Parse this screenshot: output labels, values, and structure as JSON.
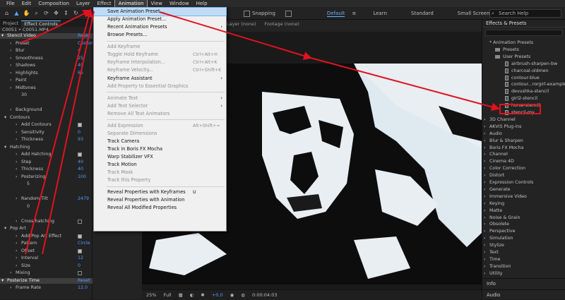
{
  "menubar": {
    "items": [
      "File",
      "Edit",
      "Composition",
      "Layer",
      "Effect",
      "Animation",
      "View",
      "Window",
      "Help"
    ],
    "active_index": 5
  },
  "toolbar": {
    "snapping_label": "Snapping",
    "workspaces": [
      "Default",
      "Learn",
      "Standard",
      "Small Screen"
    ],
    "active_workspace": "Default",
    "search_placeholder": "Search Help"
  },
  "left_panel": {
    "tabs": [
      "Project",
      "Effect Controls"
    ],
    "layer_name": "C0051 • C0051.MP4",
    "rows": [
      {
        "label": "Stencil Video",
        "value": "Reset",
        "indent": 10,
        "type": "fxhead"
      },
      {
        "label": "Preset",
        "value": "Custom",
        "indent": 22,
        "type": "prop"
      },
      {
        "label": "Blur",
        "value": "4",
        "indent": 22,
        "type": "prop"
      },
      {
        "label": "Smoothness",
        "value": "25",
        "indent": 22,
        "type": "prop"
      },
      {
        "label": "Shadows",
        "value": "40",
        "indent": 22,
        "type": "prop"
      },
      {
        "label": "Highlights",
        "value": "65",
        "indent": 22,
        "type": "prop"
      },
      {
        "label": "Paint",
        "value": "",
        "indent": 22,
        "type": "prop"
      },
      {
        "label": "Midtones",
        "value": "",
        "indent": 22,
        "type": "prop"
      },
      {
        "label": "30",
        "value": "",
        "indent": 30,
        "type": "prop"
      },
      {
        "label": "",
        "value": "",
        "indent": 0,
        "type": "blank"
      },
      {
        "label": "Background",
        "value": "",
        "indent": 22,
        "type": "prop"
      },
      {
        "label": "Contours",
        "value": "",
        "indent": 14,
        "type": "group"
      },
      {
        "label": "Add Contours",
        "value": "",
        "indent": 30,
        "type": "check"
      },
      {
        "label": "Sensitivity",
        "value": "0",
        "indent": 30,
        "type": "prop"
      },
      {
        "label": "Thickness",
        "value": "93",
        "indent": 30,
        "type": "prop"
      },
      {
        "label": "Hatching",
        "value": "",
        "indent": 14,
        "type": "group"
      },
      {
        "label": "Add Hatching",
        "value": "",
        "indent": 30,
        "type": "check"
      },
      {
        "label": "Step",
        "value": "40",
        "indent": 30,
        "type": "prop"
      },
      {
        "label": "Thickness",
        "value": "40",
        "indent": 30,
        "type": "prop"
      },
      {
        "label": "Posterizing",
        "value": "100",
        "indent": 30,
        "type": "prop"
      },
      {
        "label": "5",
        "value": "",
        "indent": 38,
        "type": "prop"
      },
      {
        "label": "",
        "value": "",
        "indent": 0,
        "type": "blank"
      },
      {
        "label": "Random Tilt",
        "value": "2479",
        "indent": 30,
        "type": "prop"
      },
      {
        "label": "0",
        "value": "",
        "indent": 38,
        "type": "prop"
      },
      {
        "label": "",
        "value": "",
        "indent": 0,
        "type": "blank"
      },
      {
        "label": "Cross-hatching",
        "value": "",
        "indent": 30,
        "type": "check-off"
      },
      {
        "label": "Pop Art",
        "value": "",
        "indent": 14,
        "type": "group"
      },
      {
        "label": "Add Pop Art Effect",
        "value": "",
        "indent": 30,
        "type": "check"
      },
      {
        "label": "Pattern",
        "value": "Circle",
        "indent": 30,
        "type": "prop"
      },
      {
        "label": "Offset",
        "value": "",
        "indent": 30,
        "type": "check"
      },
      {
        "label": "Interval",
        "value": "12",
        "indent": 30,
        "type": "prop"
      },
      {
        "label": "Size",
        "value": "0",
        "indent": 30,
        "type": "prop"
      },
      {
        "label": "Mixing",
        "value": "",
        "indent": 22,
        "type": "check-off"
      },
      {
        "label": "Posterize Time",
        "value": "Reset",
        "indent": 10,
        "type": "fxhead"
      },
      {
        "label": "Frame Rate",
        "value": "12,0",
        "indent": 22,
        "type": "prop"
      }
    ]
  },
  "comp_area": {
    "tabs": [
      "Layer (none)",
      "Footage (none)"
    ],
    "viewbar": {
      "zoom": "25%",
      "resolution": "Full",
      "exposure": "+0,0",
      "timecode": "0:00:04:03"
    }
  },
  "dropdown": {
    "items": [
      {
        "label": "Save Animation Preset...",
        "state": "highlight"
      },
      {
        "label": "Apply Animation Preset...",
        "state": "normal"
      },
      {
        "label": "Recent Animation Presets",
        "state": "normal",
        "submenu": true
      },
      {
        "label": "Browse Presets...",
        "state": "normal"
      },
      {
        "sep": true
      },
      {
        "label": "Add Keyframe",
        "state": "disabled"
      },
      {
        "label": "Toggle Hold Keyframe",
        "state": "disabled",
        "shortcut": "Ctrl+Alt+H"
      },
      {
        "label": "Keyframe Interpolation...",
        "state": "disabled",
        "shortcut": "Ctrl+Alt+K"
      },
      {
        "label": "Keyframe Velocity...",
        "state": "disabled",
        "shortcut": "Ctrl+Shift+K"
      },
      {
        "label": "Keyframe Assistant",
        "state": "normal",
        "submenu": true
      },
      {
        "label": "Add Property to Essential Graphics",
        "state": "disabled"
      },
      {
        "sep": true
      },
      {
        "label": "Animate Text",
        "state": "disabled",
        "submenu": true
      },
      {
        "label": "Add Text Selector",
        "state": "disabled",
        "submenu": true
      },
      {
        "label": "Remove All Text Animators",
        "state": "disabled"
      },
      {
        "sep": true
      },
      {
        "label": "Add Expression",
        "state": "disabled",
        "shortcut": "Alt+Shift+="
      },
      {
        "label": "Separate Dimensions",
        "state": "disabled"
      },
      {
        "label": "Track Camera",
        "state": "normal"
      },
      {
        "label": "Track in Boris FX Mocha",
        "state": "normal"
      },
      {
        "label": "Warp Stabilizer VFX",
        "state": "normal"
      },
      {
        "label": "Track Motion",
        "state": "normal"
      },
      {
        "label": "Track Mask",
        "state": "disabled"
      },
      {
        "label": "Track this Property",
        "state": "disabled"
      },
      {
        "sep": true
      },
      {
        "label": "Reveal Properties with Keyframes",
        "state": "normal",
        "shortcut": "U"
      },
      {
        "label": "Reveal Properties with Animation",
        "state": "normal"
      },
      {
        "label": "Reveal All Modified Properties",
        "state": "normal"
      }
    ]
  },
  "effects_panel": {
    "title": "Effects & Presets",
    "items": [
      {
        "label": "* Animation Presets",
        "indent": 4,
        "kind": "text"
      },
      {
        "label": "Presets",
        "indent": 18,
        "kind": "folder"
      },
      {
        "label": "User Presets",
        "indent": 18,
        "kind": "folder"
      },
      {
        "label": "airbrush-sharpen-bw",
        "indent": 32,
        "kind": "preset"
      },
      {
        "label": "charcoal-oldmen",
        "indent": 32,
        "kind": "preset"
      },
      {
        "label": "contour-blue",
        "indent": 32,
        "kind": "preset"
      },
      {
        "label": "contour...rorgirl-example",
        "indent": 32,
        "kind": "preset"
      },
      {
        "label": "devushka-stencil",
        "indent": 32,
        "kind": "preset"
      },
      {
        "label": "girl2-stencil",
        "indent": 32,
        "kind": "preset"
      },
      {
        "label": "horse-stencil",
        "indent": 32,
        "kind": "preset"
      },
      {
        "label": "stencil-my",
        "indent": 32,
        "kind": "preset"
      },
      {
        "label": "3D Channel",
        "indent": 4,
        "kind": "text"
      },
      {
        "label": "AKVIS Plug-ins",
        "indent": 4,
        "kind": "text"
      },
      {
        "label": "Audio",
        "indent": 4,
        "kind": "text"
      },
      {
        "label": "Blur & Sharpen",
        "indent": 4,
        "kind": "text"
      },
      {
        "label": "Boris FX Mocha",
        "indent": 4,
        "kind": "text"
      },
      {
        "label": "Channel",
        "indent": 4,
        "kind": "text"
      },
      {
        "label": "Cinema 4D",
        "indent": 4,
        "kind": "text"
      },
      {
        "label": "Color Correction",
        "indent": 4,
        "kind": "text"
      },
      {
        "label": "Distort",
        "indent": 4,
        "kind": "text"
      },
      {
        "label": "Expression Controls",
        "indent": 4,
        "kind": "text"
      },
      {
        "label": "Generate",
        "indent": 4,
        "kind": "text"
      },
      {
        "label": "Immersive Video",
        "indent": 4,
        "kind": "text"
      },
      {
        "label": "Keying",
        "indent": 4,
        "kind": "text"
      },
      {
        "label": "Matte",
        "indent": 4,
        "kind": "text"
      },
      {
        "label": "Noise & Grain",
        "indent": 4,
        "kind": "text"
      },
      {
        "label": "Obsolete",
        "indent": 4,
        "kind": "text"
      },
      {
        "label": "Perspective",
        "indent": 4,
        "kind": "text"
      },
      {
        "label": "Simulation",
        "indent": 4,
        "kind": "text"
      },
      {
        "label": "Stylize",
        "indent": 4,
        "kind": "text"
      },
      {
        "label": "Text",
        "indent": 4,
        "kind": "text"
      },
      {
        "label": "Time",
        "indent": 4,
        "kind": "text"
      },
      {
        "label": "Transition",
        "indent": 4,
        "kind": "text"
      },
      {
        "label": "Utility",
        "indent": 4,
        "kind": "text"
      }
    ],
    "bottom_panels": [
      "Info",
      "Audio"
    ]
  },
  "colors": {
    "accent_blue": "#4f9dff",
    "annotation_red": "#e0121f",
    "menu_bg": "#f0f0f0",
    "menu_highlight": "#bfdcf7"
  }
}
